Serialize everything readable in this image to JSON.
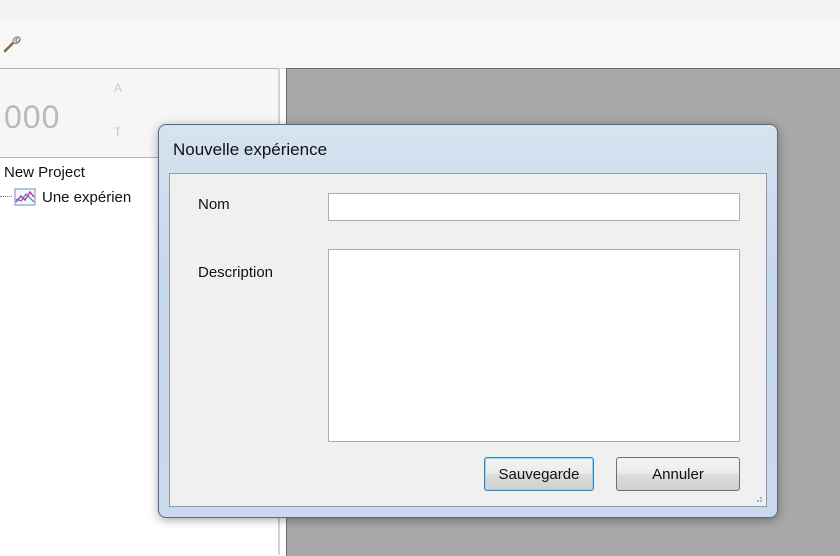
{
  "toolbar": {
    "tool_icon": "wrench-icon"
  },
  "left_panel": {
    "counter_value": "000",
    "counter_label_a": "A",
    "counter_label_t": "T",
    "tree": {
      "root_label": "New Project",
      "child_label": "Une expérien",
      "child_icon": "chart-icon"
    }
  },
  "dialog": {
    "title": "Nouvelle expérience",
    "name_label": "Nom",
    "name_value": "",
    "description_label": "Description",
    "description_value": "",
    "save_label": "Sauvegarde",
    "cancel_label": "Annuler"
  },
  "colors": {
    "dialog_frame": "#c9daec",
    "workspace": "#a8a8a8",
    "default_button_border": "#3c7fb1"
  }
}
